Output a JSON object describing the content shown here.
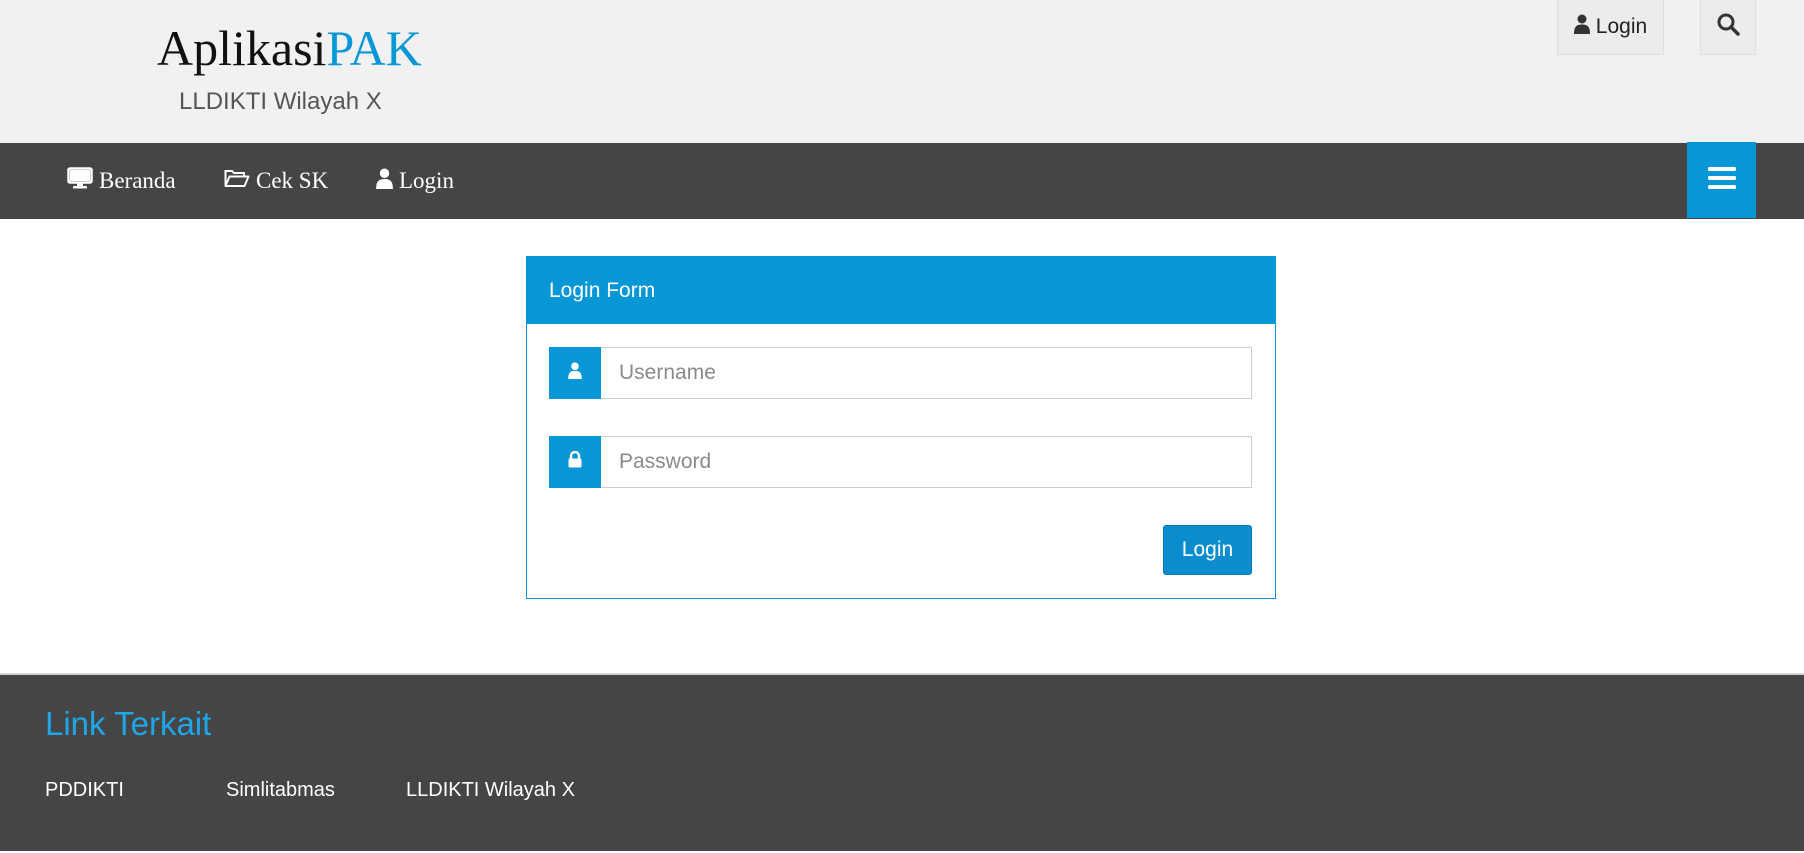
{
  "header": {
    "brand_part1": "Aplikasi",
    "brand_part2": "PAK",
    "subtitle": "LLDIKTI Wilayah X",
    "login_label": "Login",
    "icons": {
      "login": "user-icon",
      "search": "search-icon"
    }
  },
  "nav": {
    "items": [
      {
        "label": "Beranda",
        "icon": "desktop-icon"
      },
      {
        "label": "Cek SK",
        "icon": "folder-open-icon"
      },
      {
        "label": "Login",
        "icon": "user-icon"
      }
    ],
    "menu_icon": "hamburger-icon"
  },
  "login_form": {
    "title": "Login Form",
    "username_placeholder": "Username",
    "username_value": "",
    "password_placeholder": "Password",
    "password_value": "",
    "submit_label": "Login",
    "icons": {
      "username": "user-icon",
      "password": "lock-icon"
    }
  },
  "footer": {
    "title": "Link Terkait",
    "links": [
      "PDDIKTI",
      "Simlitabmas",
      "LLDIKTI Wilayah X"
    ]
  },
  "colors": {
    "accent": "#0797d6",
    "nav_bg": "#454545",
    "header_bg": "#f1f1f1",
    "footer_title": "#1ea6e8"
  }
}
